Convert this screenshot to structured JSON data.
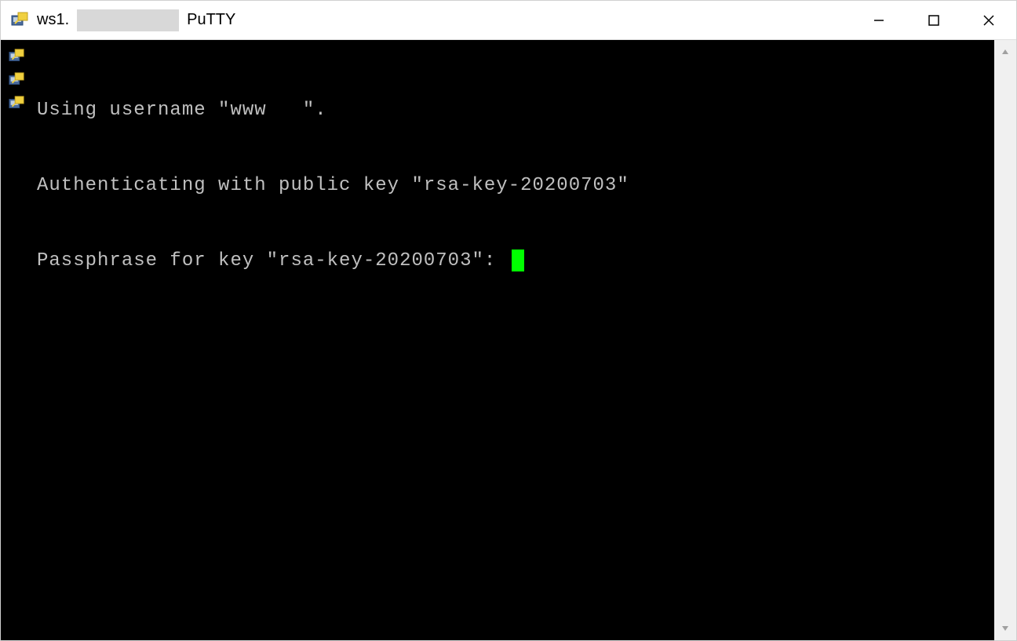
{
  "window": {
    "title_prefix": "ws1.",
    "app_name": "PuTTY"
  },
  "terminal": {
    "lines": [
      "Using username \"www   \".",
      "Authenticating with public key \"rsa-key-20200703\"",
      "Passphrase for key \"rsa-key-20200703\": "
    ]
  }
}
